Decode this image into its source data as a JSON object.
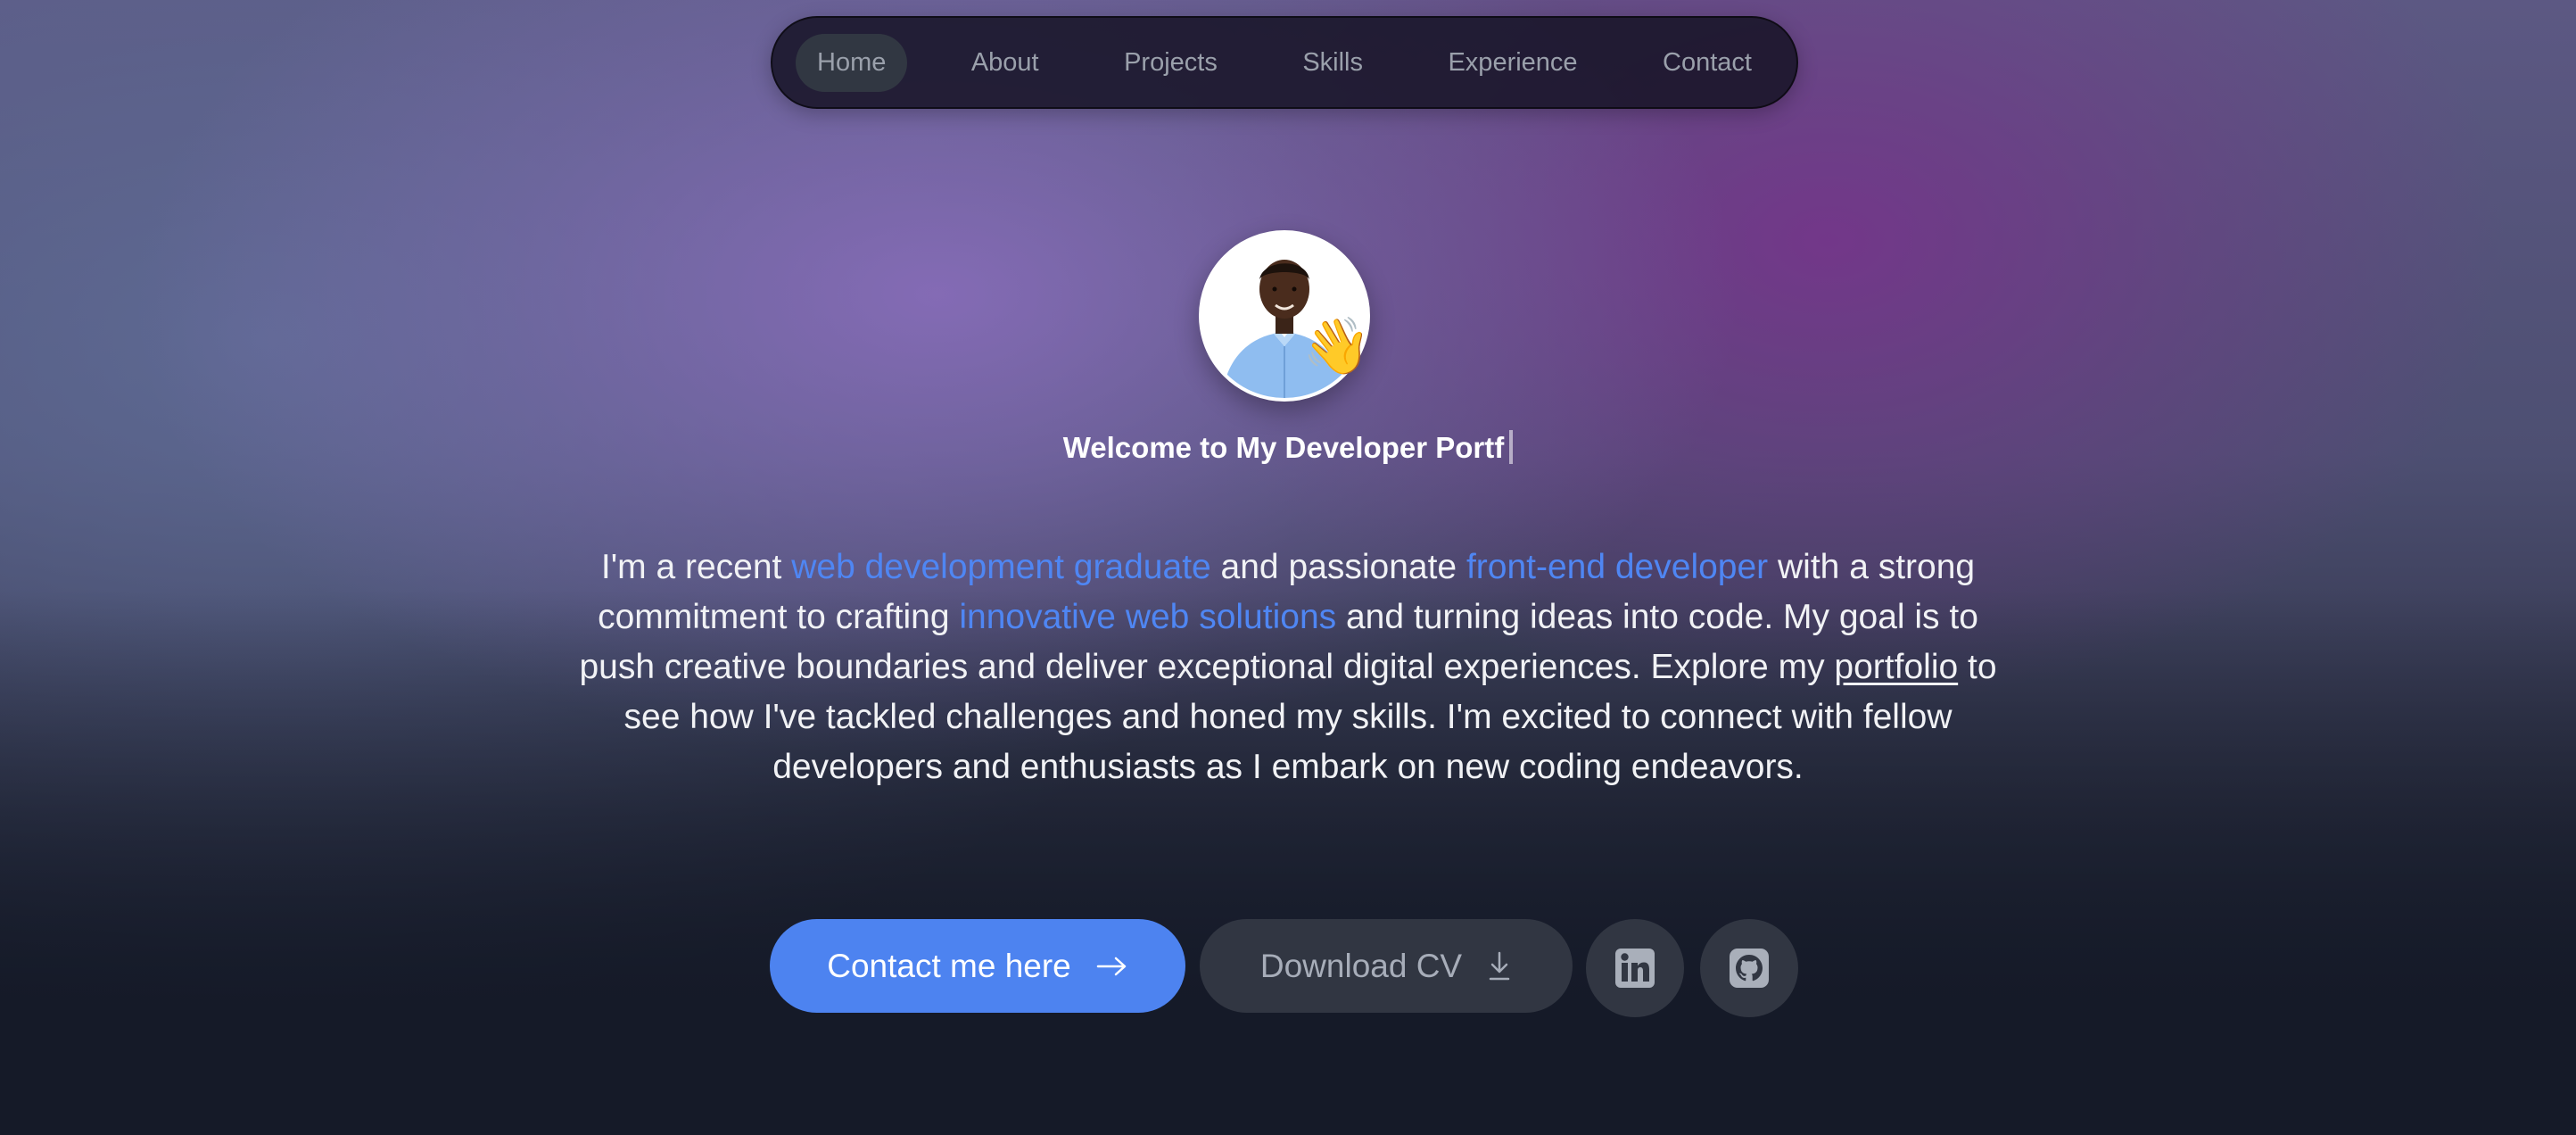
{
  "nav": {
    "items": [
      {
        "label": "Home",
        "active": true
      },
      {
        "label": "About"
      },
      {
        "label": "Projects"
      },
      {
        "label": "Skills"
      },
      {
        "label": "Experience"
      },
      {
        "label": "Contact"
      }
    ]
  },
  "hero": {
    "avatar_icon": "profile-photo",
    "wave_emoji": "👋",
    "headline": "Welcome to My Developer Portf",
    "intro": {
      "t1": "I'm a recent ",
      "h1": "web development graduate",
      "t2": " and passionate ",
      "h2": "front-end developer",
      "t3": " with a strong commitment to crafting ",
      "h3": "innovative web solutions",
      "t4": " and turning ideas into code. My goal is to push creative boundaries and deliver exceptional digital experiences. Explore my ",
      "link": "portfolio",
      "t5": " to see how I've tackled challenges and honed my skills. I'm excited to connect with fellow developers and enthusiasts as I embark on new coding endeavors."
    },
    "buttons": {
      "contact_label": "Contact me here",
      "contact_icon": "arrow-right-icon",
      "cv_label": "Download CV",
      "cv_icon": "download-icon",
      "linkedin_icon": "linkedin-icon",
      "github_icon": "github-icon"
    }
  },
  "colors": {
    "accent": "#4d83f0",
    "highlight_text": "#4f86f3",
    "button_dark": "#313642",
    "nav_bg": "#18142a"
  }
}
